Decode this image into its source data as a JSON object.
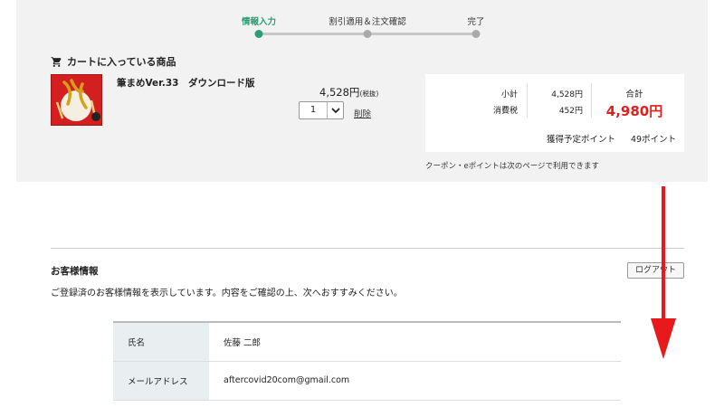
{
  "steps": [
    {
      "label": "情報入力",
      "active": true
    },
    {
      "label": "割引適用＆注文確認",
      "active": false
    },
    {
      "label": "完了",
      "active": false
    }
  ],
  "cart": {
    "heading": "カートに入っている商品",
    "product": {
      "name": "筆まめVer.33　ダウンロード版",
      "price": "4,528円",
      "price_note": "(税抜)",
      "quantity": "1",
      "delete_label": "削除"
    }
  },
  "summary": {
    "subtotal_label": "小計",
    "subtotal_value": "4,528円",
    "tax_label": "消費税",
    "tax_value": "452円",
    "total_label": "合計",
    "total_value": "4,980円",
    "points_label": "獲得予定ポイント",
    "points_value": "49ポイント"
  },
  "coupon_note": "クーポン・eポイントは次のページで利用できます",
  "customer": {
    "title": "お客様情報",
    "logout_label": "ログアウト",
    "description": "ご登録済のお客様情報を表示しています。内容をご確認の上、次へおすすみください。",
    "rows": [
      {
        "label": "氏名",
        "value": "佐藤 二郎"
      },
      {
        "label": "メールアドレス",
        "value": "aftercovid20com@gmail.com"
      }
    ]
  },
  "colors": {
    "accent": "#2a9d73",
    "price_red": "#e0201e",
    "arrow_red": "#e8191a"
  }
}
